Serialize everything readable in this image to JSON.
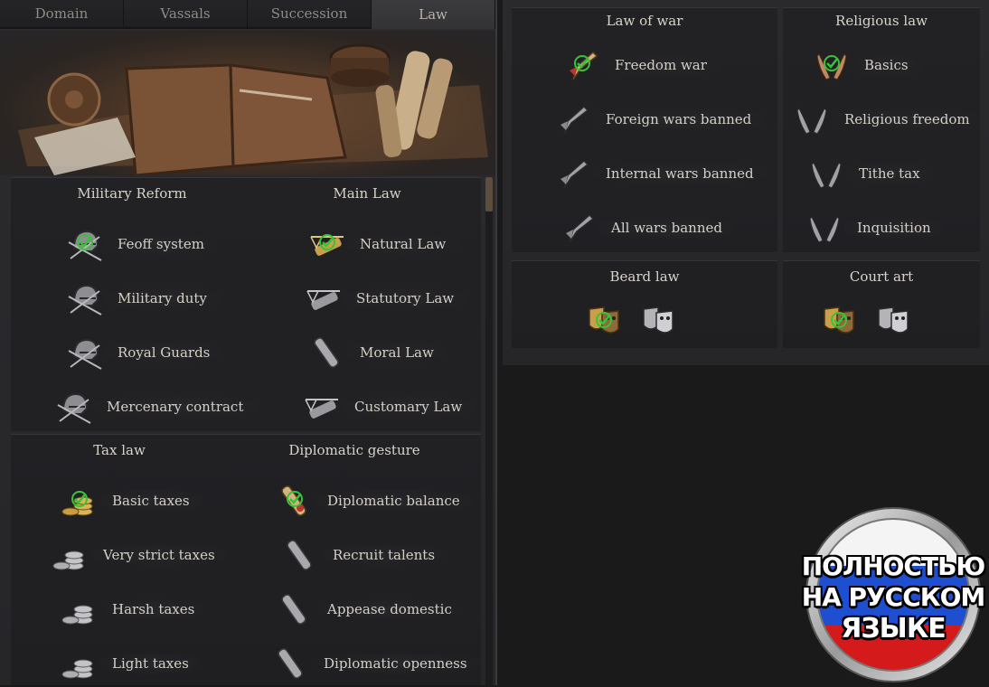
{
  "tabs": [
    {
      "label": "Domain"
    },
    {
      "label": "Vassals"
    },
    {
      "label": "Succession"
    },
    {
      "label": "Law"
    }
  ],
  "active_tab": "Law",
  "groups": {
    "military_reform": {
      "title": "Military Reform",
      "laws": [
        "Feoff system",
        "Military duty",
        "Royal Guards",
        "Mercenary contract"
      ],
      "active_index": 0,
      "icon": "helmet-icon"
    },
    "main_law": {
      "title": "Main Law",
      "laws": [
        "Natural Law",
        "Statutory Law",
        "Moral Law",
        "Customary Law"
      ],
      "active_index": 0,
      "icon": "scales-icon"
    },
    "tax_law": {
      "title": "Tax law",
      "laws": [
        "Basic taxes",
        "Very strict taxes",
        "Harsh taxes",
        "Light taxes"
      ],
      "active_index": 0,
      "icon": "coins-icon"
    },
    "diplomatic_gesture": {
      "title": "Diplomatic gesture",
      "laws": [
        "Diplomatic balance",
        "Recruit talents",
        "Appease domestic",
        "Diplomatic openness"
      ],
      "active_index": 0,
      "icon": "scroll-icon"
    },
    "law_of_war": {
      "title": "Law of war",
      "laws": [
        "Freedom war",
        "Foreign wars banned",
        "Internal wars banned",
        "All wars banned"
      ],
      "active_index": 0,
      "icon": "horn-icon"
    },
    "religious_law": {
      "title": "Religious law",
      "laws": [
        "Basics",
        "Religious freedom",
        "Tithe tax",
        "Inquisition"
      ],
      "active_index": 0,
      "icon": "praying-hands-icon"
    },
    "beard_law": {
      "title": "Beard law",
      "active_index": 0,
      "icon": "theater-masks-icon"
    },
    "court_art": {
      "title": "Court art",
      "active_index": 0,
      "icon": "theater-masks-icon"
    }
  },
  "badge": {
    "lines": [
      "ПОЛНОСТЬЮ",
      "НА РУССКОМ",
      "ЯЗЫКЕ"
    ],
    "colors": [
      "#ffffff",
      "#1d4fd0",
      "#d41a1a"
    ]
  },
  "colors": {
    "active_check": "#37c23a",
    "active_tint": "#c9a04a",
    "inactive_tint": "#9a9a9e"
  }
}
